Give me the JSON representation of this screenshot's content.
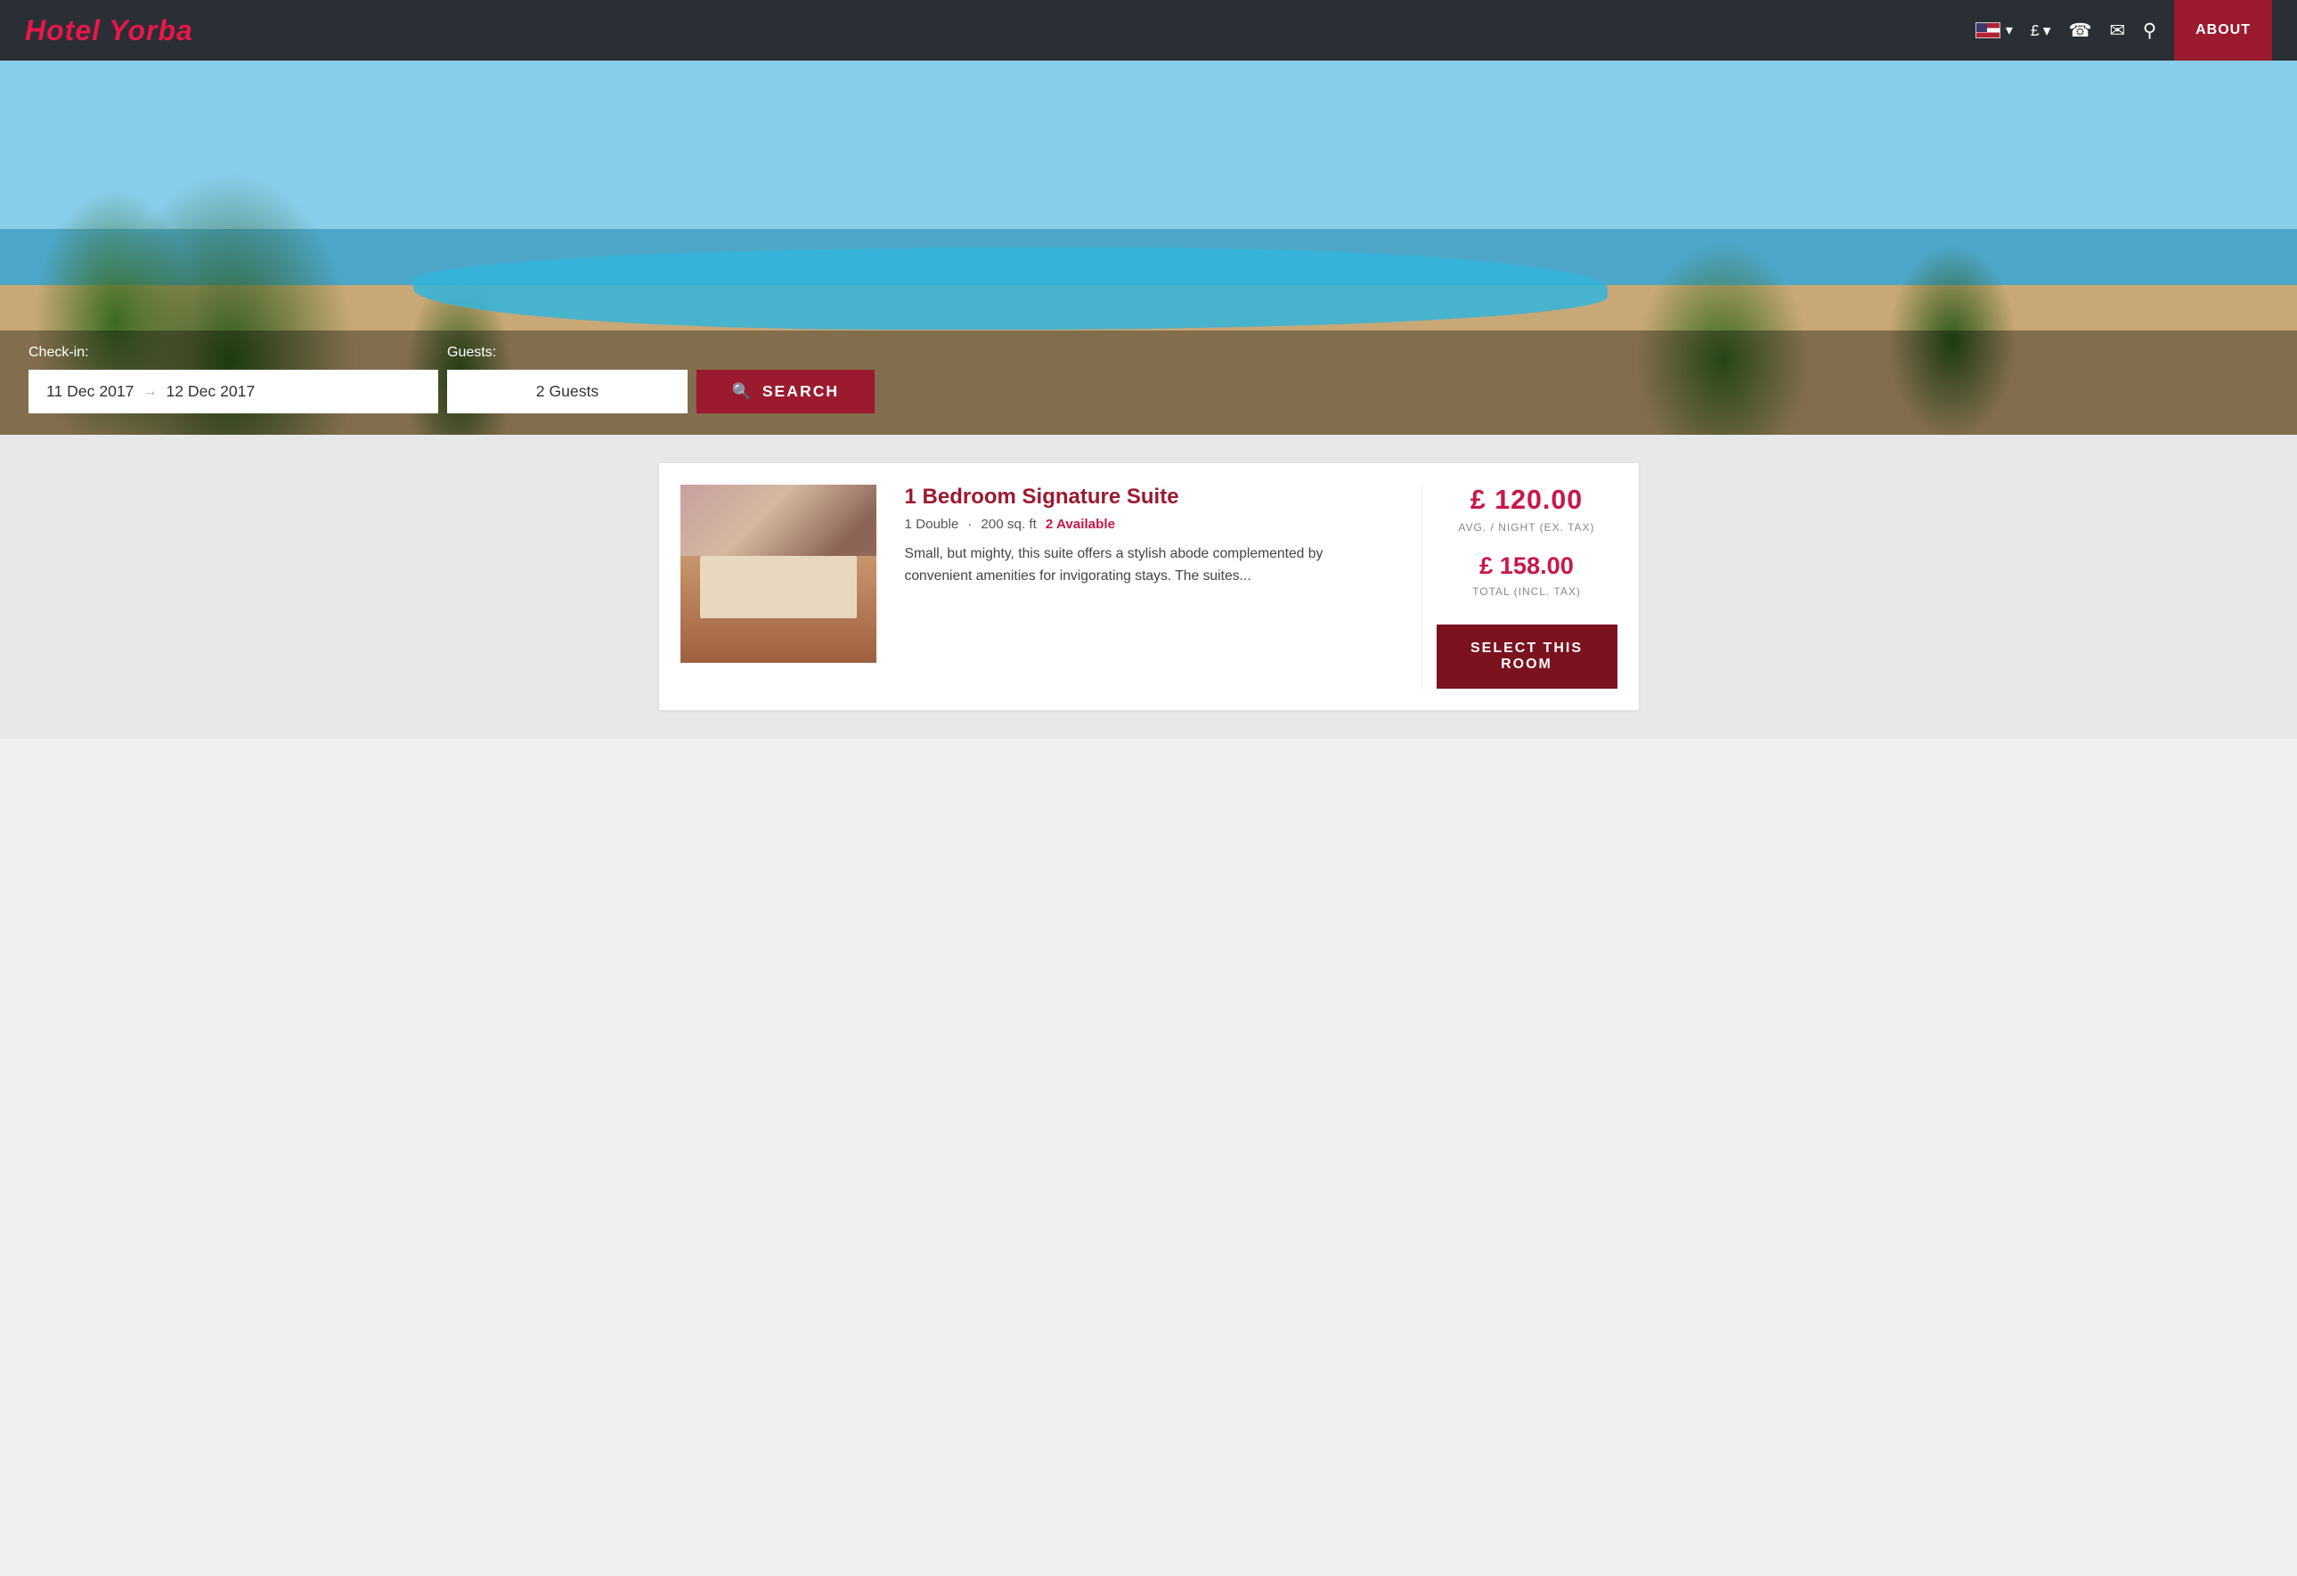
{
  "brand": {
    "name": "Hotel Yorba"
  },
  "navbar": {
    "flag_label": "US Flag",
    "currency_symbol": "£",
    "currency_chevron": "▾",
    "flag_chevron": "▾",
    "phone_icon": "☎",
    "mail_icon": "✉",
    "location_icon": "⚲",
    "about_label": "ABOUT"
  },
  "hero": {
    "checkin_label": "Check-in:",
    "guests_label": "Guests:",
    "checkin_value": "11 Dec 2017",
    "arrow": "→",
    "checkout_value": "12 Dec 2017",
    "guests_value": "2 Guests",
    "search_icon": "🔍",
    "search_label": "SEARCH"
  },
  "room": {
    "title": "1 Bedroom Signature Suite",
    "bed_type": "1 Double",
    "size": "200 sq. ft",
    "availability": "2 Available",
    "description": "Small, but mighty, this suite offers a stylish abode complemented by convenient amenities for invigorating stays. The suites...",
    "price_main": "£ 120.00",
    "price_label": "AVG. / NIGHT (EX. TAX)",
    "price_total": "£ 158.00",
    "price_total_label": "TOTAL (INCL. TAX)",
    "select_btn": "SELECT THIS ROOM"
  }
}
